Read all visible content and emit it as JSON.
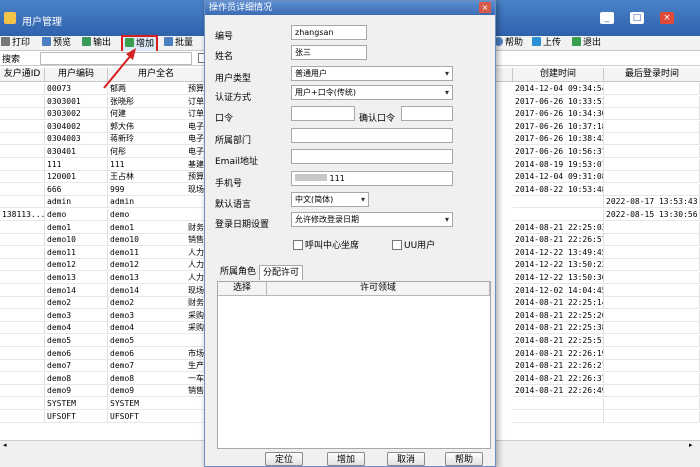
{
  "main": {
    "title": "用户管理",
    "toolbar_left": [
      {
        "label": "打印",
        "icon": "printer-icon"
      },
      {
        "label": "预览",
        "icon": "preview-icon"
      },
      {
        "label": "输出",
        "icon": "export-icon"
      },
      {
        "label": "增加",
        "icon": "add-icon"
      },
      {
        "label": "批量",
        "icon": "batch-icon"
      }
    ],
    "toolbar_right": [
      {
        "label": "帮助",
        "icon": "help-icon"
      },
      {
        "label": "上传",
        "icon": "upload-icon"
      },
      {
        "label": "退出",
        "icon": "exit-icon"
      }
    ],
    "search_label": "搜索",
    "columns": [
      "友户通ID",
      "用户编码",
      "用户全名",
      "创建时间",
      "最后登录时间"
    ],
    "rows": [
      {
        "yht": "",
        "code": "00073",
        "name": "郁两",
        "mid": "预算",
        "created": "2014-12-04 09:34:54",
        "last": ""
      },
      {
        "yht": "",
        "code": "0303001",
        "name": "张晓彤",
        "mid": "订单",
        "created": "2017-06-26 10:33:51",
        "last": ""
      },
      {
        "yht": "",
        "code": "0303002",
        "name": "何建",
        "mid": "订单",
        "created": "2017-06-26 10:34:30",
        "last": ""
      },
      {
        "yht": "",
        "code": "0304002",
        "name": "郭大伟",
        "mid": "电子",
        "created": "2017-06-26 10:37:18",
        "last": ""
      },
      {
        "yht": "",
        "code": "0304003",
        "name": "蒋新玲",
        "mid": "电子",
        "created": "2017-06-26 10:38:43",
        "last": ""
      },
      {
        "yht": "",
        "code": "030401",
        "name": "何彤",
        "mid": "电子",
        "created": "2017-06-26 10:56:37",
        "last": ""
      },
      {
        "yht": "",
        "code": "111",
        "name": "111",
        "mid": "基建",
        "created": "2014-08-19 19:53:07",
        "last": ""
      },
      {
        "yht": "",
        "code": "120001",
        "name": "王占林",
        "mid": "预算",
        "created": "2014-12-04 09:31:08",
        "last": ""
      },
      {
        "yht": "",
        "code": "666",
        "name": "999",
        "mid": "现场",
        "created": "2014-08-22 10:53:48",
        "last": ""
      },
      {
        "yht": "",
        "code": "admin",
        "name": "admin",
        "mid": "",
        "created": "",
        "last": "2022-08-17 13:53:43"
      },
      {
        "yht": "138113...",
        "code": "demo",
        "name": "demo",
        "mid": "",
        "created": "",
        "last": "2022-08-15 13:30:56"
      },
      {
        "yht": "",
        "code": "demo1",
        "name": "demo1",
        "mid": "财务",
        "created": "2014-08-21 22:25:03",
        "last": ""
      },
      {
        "yht": "",
        "code": "demo10",
        "name": "demo10",
        "mid": "销售",
        "created": "2014-08-21 22:26:57",
        "last": ""
      },
      {
        "yht": "",
        "code": "demo11",
        "name": "demo11",
        "mid": "人力",
        "created": "2014-12-22 13:49:45",
        "last": ""
      },
      {
        "yht": "",
        "code": "demo12",
        "name": "demo12",
        "mid": "人力",
        "created": "2014-12-22 13:50:22",
        "last": ""
      },
      {
        "yht": "",
        "code": "demo13",
        "name": "demo13",
        "mid": "人力",
        "created": "2014-12-22 13:50:36",
        "last": ""
      },
      {
        "yht": "",
        "code": "demo14",
        "name": "demo14",
        "mid": "现场",
        "created": "2014-12-02 14:04:45",
        "last": ""
      },
      {
        "yht": "",
        "code": "demo2",
        "name": "demo2",
        "mid": "财务",
        "created": "2014-08-21 22:25:14",
        "last": ""
      },
      {
        "yht": "",
        "code": "demo3",
        "name": "demo3",
        "mid": "采购",
        "created": "2014-08-21 22:25:26",
        "last": ""
      },
      {
        "yht": "",
        "code": "demo4",
        "name": "demo4",
        "mid": "采购",
        "created": "2014-08-21 22:25:38",
        "last": ""
      },
      {
        "yht": "",
        "code": "demo5",
        "name": "demo5",
        "mid": "",
        "created": "2014-08-21 22:25:51",
        "last": ""
      },
      {
        "yht": "",
        "code": "demo6",
        "name": "demo6",
        "mid": "市场",
        "created": "2014-08-21 22:26:19",
        "last": ""
      },
      {
        "yht": "",
        "code": "demo7",
        "name": "demo7",
        "mid": "生产",
        "created": "2014-08-21 22:26:27",
        "last": ""
      },
      {
        "yht": "",
        "code": "demo8",
        "name": "demo8",
        "mid": "一车",
        "created": "2014-08-21 22:26:37",
        "last": ""
      },
      {
        "yht": "",
        "code": "demo9",
        "name": "demo9",
        "mid": "销售",
        "created": "2014-08-21 22:26:49",
        "last": ""
      },
      {
        "yht": "",
        "code": "SYSTEM",
        "name": "SYSTEM",
        "mid": "",
        "created": "",
        "last": ""
      },
      {
        "yht": "",
        "code": "UFSOFT",
        "name": "UFSOFT",
        "mid": "",
        "created": "",
        "last": ""
      }
    ]
  },
  "dialog": {
    "title": "操作员详细情况",
    "fields": {
      "code": {
        "label": "编号",
        "value": "zhangsan"
      },
      "name": {
        "label": "姓名",
        "value": "张三"
      },
      "user_type": {
        "label": "用户类型",
        "value": "普通用户"
      },
      "auth": {
        "label": "认证方式",
        "value": "用户+口令(传统)"
      },
      "password": {
        "label": "口令",
        "value": ""
      },
      "confirm": {
        "label": "确认口令",
        "value": ""
      },
      "dept": {
        "label": "所属部门",
        "value": ""
      },
      "email": {
        "label": "Email地址",
        "value": ""
      },
      "phone": {
        "label": "手机号",
        "value": "111"
      },
      "lang": {
        "label": "默认语言",
        "value": "中文(简体)"
      },
      "login_date": {
        "label": "登录日期设置",
        "value": "允许修改登录日期"
      }
    },
    "checkboxes": {
      "call_center": "呼叫中心坐席",
      "uu_user": "UU用户"
    },
    "tabs": [
      "所属角色",
      "分配许可"
    ],
    "table_headers": [
      "选择",
      "许可领域"
    ],
    "buttons": {
      "locate": "定位",
      "add": "增加",
      "cancel": "取消",
      "help": "帮助"
    }
  },
  "colors": {
    "title_bar": "#2f62ad",
    "highlight": "#d42020"
  }
}
